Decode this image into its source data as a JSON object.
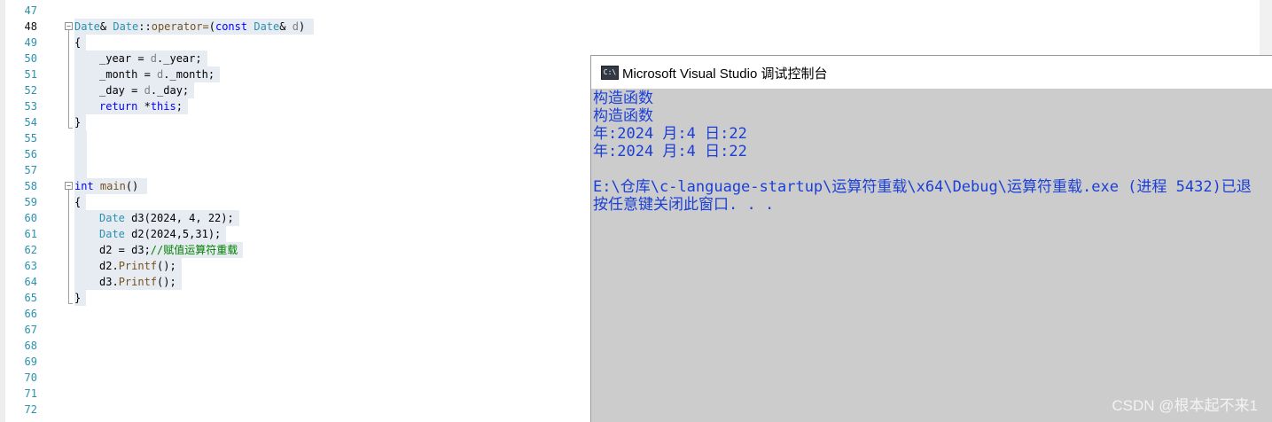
{
  "editor": {
    "line_numbers": [
      "47",
      "48",
      "49",
      "50",
      "51",
      "52",
      "53",
      "54",
      "55",
      "56",
      "57",
      "58",
      "59",
      "60",
      "61",
      "62",
      "63",
      "64",
      "65",
      "66",
      "67",
      "68",
      "69",
      "70",
      "71",
      "72"
    ],
    "current_line": "48",
    "code": {
      "l48": {
        "t1": "Date",
        "t2": "& ",
        "t3": "Date",
        "t4": "::",
        "t5": "operator=",
        "t6": "(",
        "t7": "const",
        "t8": " ",
        "t9": "Date",
        "t10": "& ",
        "t11": "d",
        "t12": ")"
      },
      "l49": "{",
      "l50": {
        "t1": "_year = ",
        "t2": "d",
        "t3": "._year;"
      },
      "l51": {
        "t1": "_month = ",
        "t2": "d",
        "t3": "._month;"
      },
      "l52": {
        "t1": "_day = ",
        "t2": "d",
        "t3": "._day;"
      },
      "l53": {
        "t1": "return",
        "t2": " *",
        "t3": "this",
        "t4": ";"
      },
      "l54": "}",
      "l58": {
        "t1": "int",
        "t2": " ",
        "t3": "main",
        "t4": "()"
      },
      "l59": "{",
      "l60": {
        "t1": "Date",
        "t2": " d3(2024, 4, 22);"
      },
      "l61": {
        "t1": "Date",
        "t2": " d2(2024,5,31);"
      },
      "l62": {
        "t1": "d2 = d3;",
        "t2": "//赋值运算符重载"
      },
      "l63": {
        "t1": "d2.",
        "t2": "Printf",
        "t3": "();"
      },
      "l64": {
        "t1": "d3.",
        "t2": "Printf",
        "t3": "();"
      },
      "l65": "}"
    }
  },
  "console": {
    "icon_text": "C:\\",
    "title": "Microsoft Visual Studio 调试控制台",
    "lines": [
      "构造函数",
      "构造函数",
      "年:2024 月:4 日:22",
      "年:2024 月:4 日:22",
      "",
      "E:\\仓库\\c-language-startup\\运算符重载\\x64\\Debug\\运算符重载.exe (进程 5432)已退",
      "按任意键关闭此窗口. . ."
    ]
  },
  "watermark": "CSDN @根本起不来1",
  "colors": {
    "keyword": "#0000ff",
    "type": "#2b91af",
    "function": "#74531f",
    "comment": "#008000",
    "parameter": "#808080",
    "console_text": "#1a3fd6",
    "console_bg": "#cccccc"
  }
}
